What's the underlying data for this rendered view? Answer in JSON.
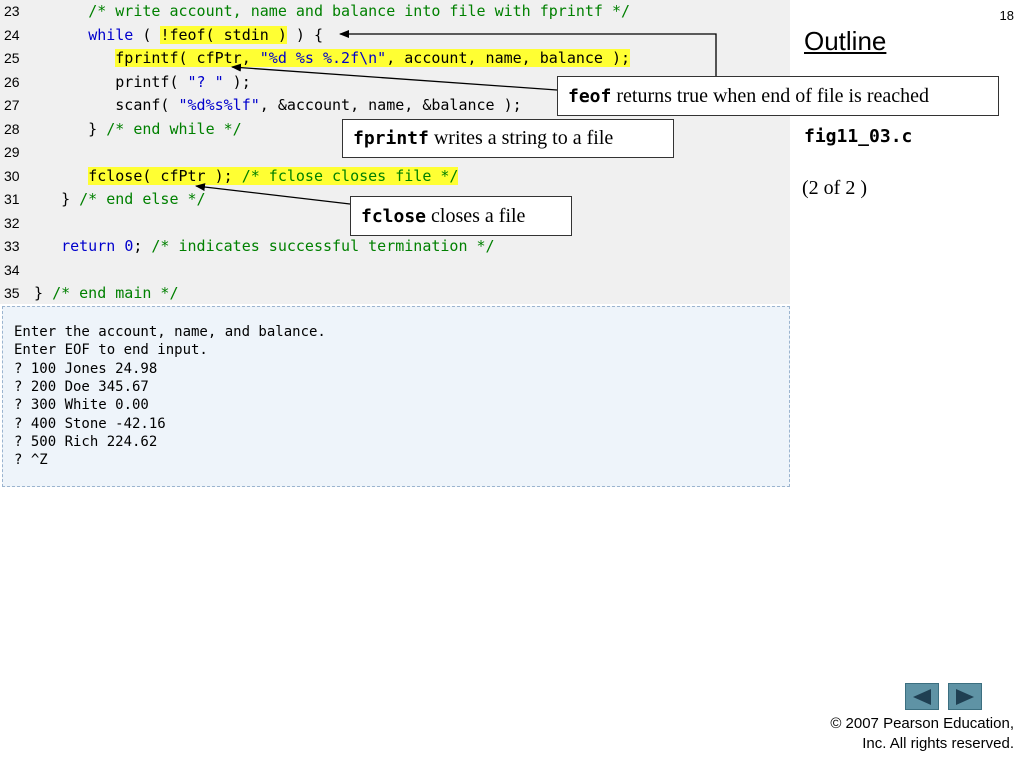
{
  "slide_number": "18",
  "outline": {
    "title": "Outline",
    "file_name": "fig11_03.c",
    "page_indicator": "(2 of 2 )"
  },
  "code_lines": [
    {
      "num": "23",
      "segments": [
        {
          "t": "      ",
          "c": "df"
        },
        {
          "t": "/* write account, name and balance into file with fprintf */",
          "c": "cm"
        }
      ]
    },
    {
      "num": "24",
      "segments": [
        {
          "t": "      ",
          "c": "df"
        },
        {
          "t": "while",
          "c": "kw"
        },
        {
          "t": " ( ",
          "c": "df"
        },
        {
          "t": "!feof( stdin )",
          "c": "df",
          "hl": true
        },
        {
          "t": " ) {",
          "c": "df"
        }
      ]
    },
    {
      "num": "25",
      "segments": [
        {
          "t": "         ",
          "c": "df"
        },
        {
          "t": "fprintf( cfPtr, ",
          "c": "df",
          "hl": true
        },
        {
          "t": "\"%d %s %.2f\\n\"",
          "c": "st",
          "hl": true
        },
        {
          "t": ", account, name, balance );",
          "c": "df",
          "hl": true
        }
      ]
    },
    {
      "num": "26",
      "segments": [
        {
          "t": "         printf( ",
          "c": "df"
        },
        {
          "t": "\"? \"",
          "c": "st"
        },
        {
          "t": " );",
          "c": "df"
        }
      ]
    },
    {
      "num": "27",
      "segments": [
        {
          "t": "         scanf( ",
          "c": "df"
        },
        {
          "t": "\"%d%s%lf\"",
          "c": "st"
        },
        {
          "t": ", &account, name, &balance );",
          "c": "df"
        }
      ]
    },
    {
      "num": "28",
      "segments": [
        {
          "t": "      } ",
          "c": "df"
        },
        {
          "t": "/* end while */",
          "c": "cm"
        }
      ]
    },
    {
      "num": "29",
      "segments": []
    },
    {
      "num": "30",
      "segments": [
        {
          "t": "      ",
          "c": "df"
        },
        {
          "t": "fclose( cfPtr ); ",
          "c": "df",
          "hl": true
        },
        {
          "t": "/* fclose closes file */",
          "c": "cm",
          "hl": true
        }
      ]
    },
    {
      "num": "31",
      "segments": [
        {
          "t": "   } ",
          "c": "df"
        },
        {
          "t": "/* end else */",
          "c": "cm"
        }
      ]
    },
    {
      "num": "32",
      "segments": []
    },
    {
      "num": "33",
      "segments": [
        {
          "t": "   ",
          "c": "df"
        },
        {
          "t": "return",
          "c": "kw"
        },
        {
          "t": " ",
          "c": "df"
        },
        {
          "t": "0",
          "c": "nm"
        },
        {
          "t": "; ",
          "c": "df"
        },
        {
          "t": "/* indicates successful termination */",
          "c": "cm"
        }
      ]
    },
    {
      "num": "34",
      "segments": []
    },
    {
      "num": "35",
      "segments": [
        {
          "t": "} ",
          "c": "df"
        },
        {
          "t": "/* end main */",
          "c": "cm"
        }
      ]
    }
  ],
  "output_lines": [
    "Enter the account, name, and balance.",
    "Enter EOF to end input.",
    "? 100 Jones 24.98",
    "? 200 Doe 345.67",
    "? 300 White 0.00",
    "? 400 Stone -42.16",
    "? 500 Rich 224.62",
    "? ^Z"
  ],
  "callouts": {
    "feof": {
      "code": "feof",
      "text": " returns true when end of file is reached"
    },
    "fprintf": {
      "code": "fprintf",
      "text": " writes a string to a file"
    },
    "fclose": {
      "code": "fclose",
      "text": " closes a file"
    }
  },
  "copyright": {
    "line1": "© 2007 Pearson Education,",
    "line2": "Inc.  All rights reserved."
  },
  "colors": {
    "highlight": "#ffff33",
    "comment": "#008000",
    "keyword": "#0000cc",
    "nav_button": "#5f93a5"
  },
  "icons": {
    "prev": "left-triangle-icon",
    "next": "right-triangle-icon"
  }
}
